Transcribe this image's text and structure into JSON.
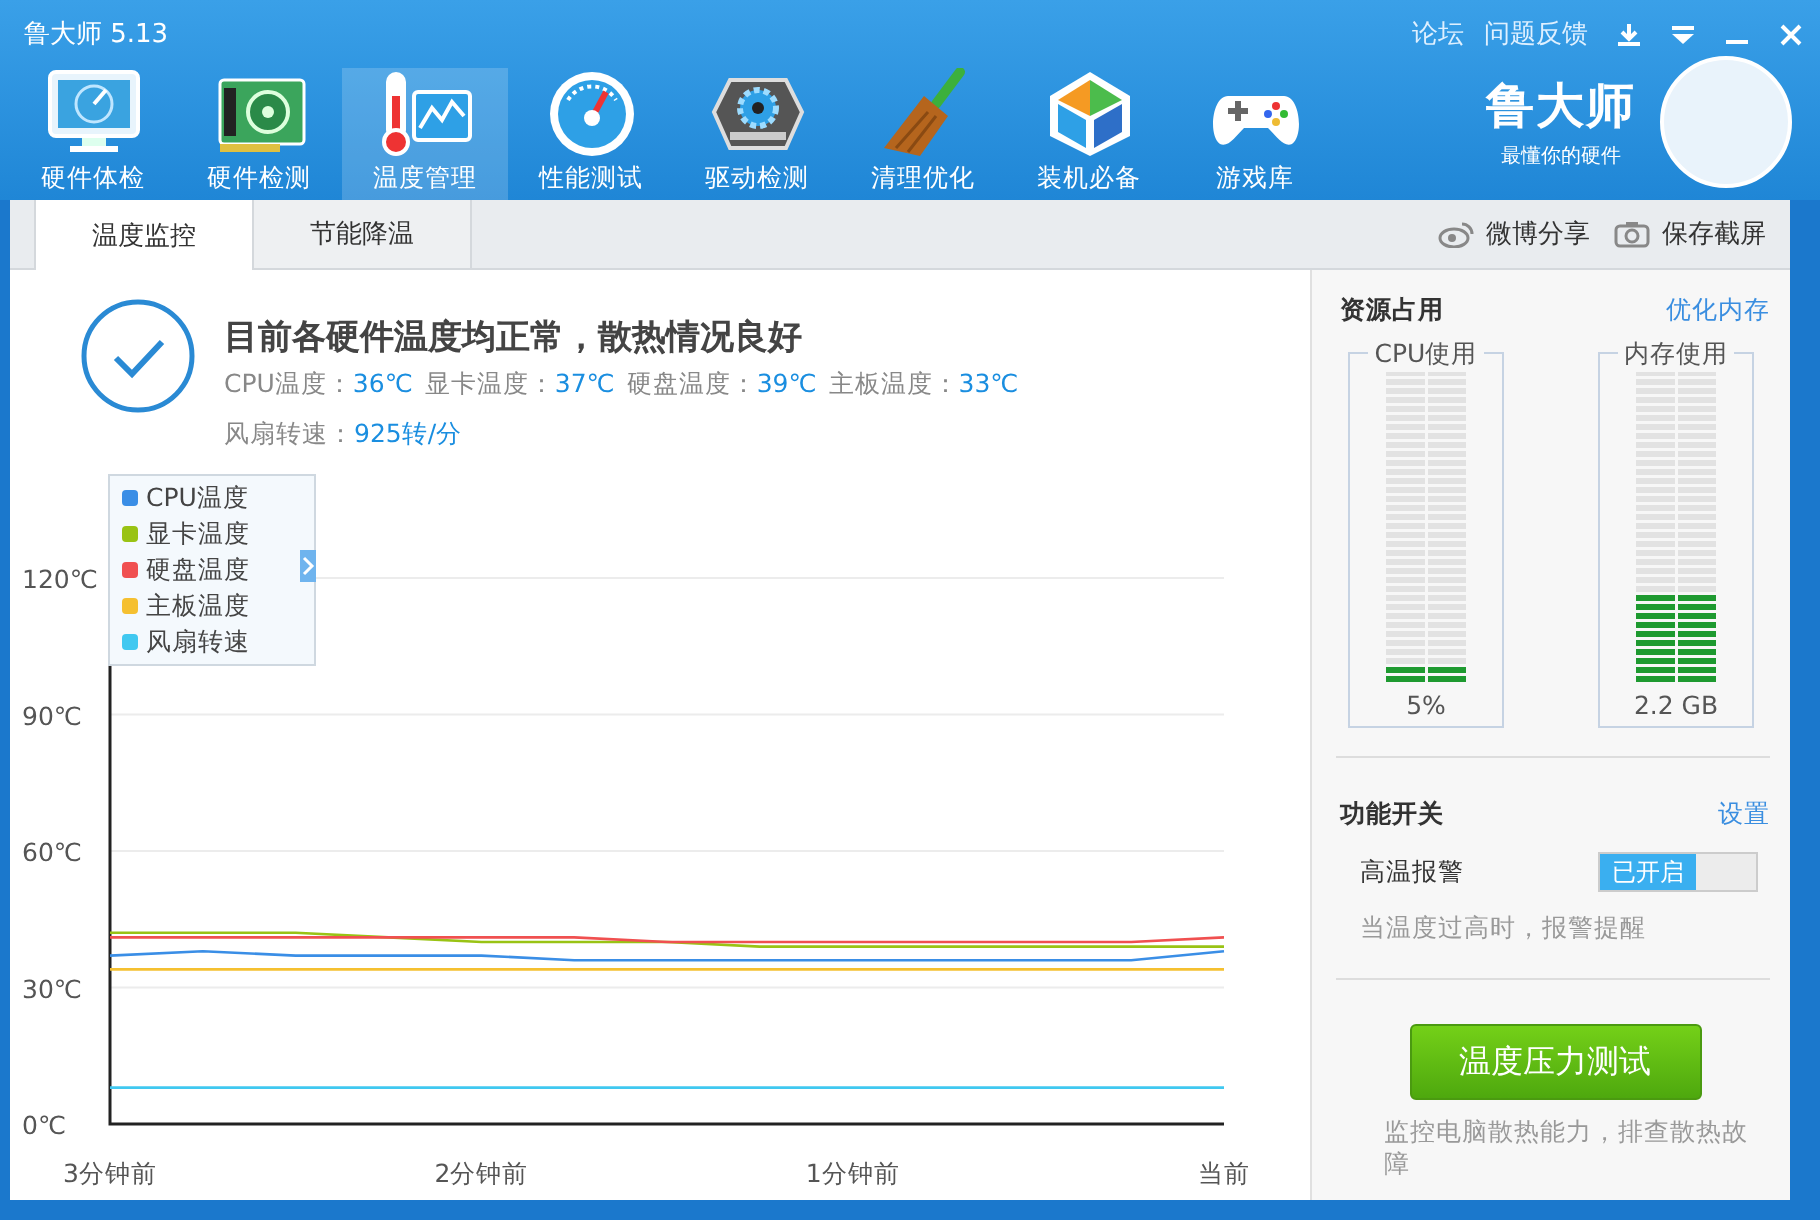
{
  "window": {
    "title": "鲁大师 5.13",
    "links": [
      "论坛",
      "问题反馈"
    ]
  },
  "nav": [
    {
      "label": "硬件体检",
      "selected": false
    },
    {
      "label": "硬件检测",
      "selected": false
    },
    {
      "label": "温度管理",
      "selected": true
    },
    {
      "label": "性能测试",
      "selected": false
    },
    {
      "label": "驱动检测",
      "selected": false
    },
    {
      "label": "清理优化",
      "selected": false
    },
    {
      "label": "装机必备",
      "selected": false
    },
    {
      "label": "游戏库",
      "selected": false
    }
  ],
  "brand": {
    "name": "鲁大师",
    "slogan": "最懂你的硬件"
  },
  "tabs": [
    {
      "label": "温度监控",
      "selected": true
    },
    {
      "label": "节能降温",
      "selected": false
    }
  ],
  "share_actions": [
    "微博分享",
    "保存截屏"
  ],
  "status": {
    "headline": "目前各硬件温度均正常，散热情况良好",
    "readings": [
      {
        "label": "CPU温度：",
        "value": "36℃"
      },
      {
        "label": "显卡温度：",
        "value": "37℃"
      },
      {
        "label": "硬盘温度：",
        "value": "39℃"
      },
      {
        "label": "主板温度：",
        "value": "33℃"
      }
    ],
    "fan": {
      "label": "风扇转速：",
      "value": "925转/分"
    }
  },
  "chart": {
    "chart_data": {
      "type": "line",
      "x": [
        3,
        2.75,
        2.5,
        2.25,
        2,
        1.75,
        1.5,
        1.25,
        1,
        0.75,
        0.5,
        0.25,
        0
      ],
      "xlim": [
        3,
        0
      ],
      "ylim": [
        0,
        120
      ],
      "grid": true,
      "xticks": [
        {
          "value": 3,
          "label": "3分钟前"
        },
        {
          "value": 2,
          "label": "2分钟前"
        },
        {
          "value": 1,
          "label": "1分钟前"
        },
        {
          "value": 0,
          "label": "当前"
        }
      ],
      "yticks": [
        {
          "value": 0,
          "label": "0℃"
        },
        {
          "value": 30,
          "label": "30℃"
        },
        {
          "value": 60,
          "label": "60℃"
        },
        {
          "value": 90,
          "label": "90℃"
        },
        {
          "value": 120,
          "label": "120℃"
        }
      ],
      "series": [
        {
          "name": "CPU温度",
          "color": "#3a8ee6",
          "values": [
            37,
            38,
            37,
            37,
            37,
            36,
            36,
            36,
            36,
            36,
            36,
            36,
            38
          ]
        },
        {
          "name": "显卡温度",
          "color": "#99c314",
          "values": [
            42,
            42,
            42,
            41,
            40,
            40,
            40,
            39,
            39,
            39,
            39,
            39,
            39
          ]
        },
        {
          "name": "硬盘温度",
          "color": "#f05050",
          "values": [
            41,
            41,
            41,
            41,
            41,
            41,
            40,
            40,
            40,
            40,
            40,
            40,
            41
          ]
        },
        {
          "name": "主板温度",
          "color": "#f5c030",
          "values": [
            34,
            34,
            34,
            34,
            34,
            34,
            34,
            34,
            34,
            34,
            34,
            34,
            34
          ]
        },
        {
          "name": "风扇转速",
          "color": "#40c8f0",
          "values": [
            8,
            8,
            8,
            8,
            8,
            8,
            8,
            8,
            8,
            8,
            8,
            8,
            8
          ]
        }
      ]
    }
  },
  "resources": {
    "title": "资源占用",
    "action": "优化内存",
    "meters": [
      {
        "label": "CPU使用",
        "level": 0.05,
        "reading": "5%"
      },
      {
        "label": "内存使用",
        "level": 0.3,
        "reading": "2.2 GB"
      }
    ]
  },
  "switches": {
    "title": "功能开关",
    "action": "设置",
    "items": [
      {
        "label": "高温报警",
        "on": true,
        "state_text": "已开启",
        "description": "当温度过高时，报警提醒"
      }
    ]
  },
  "stress_test": {
    "button": "温度压力测试",
    "caption": "监控电脑散热能力，排查散热故障"
  }
}
